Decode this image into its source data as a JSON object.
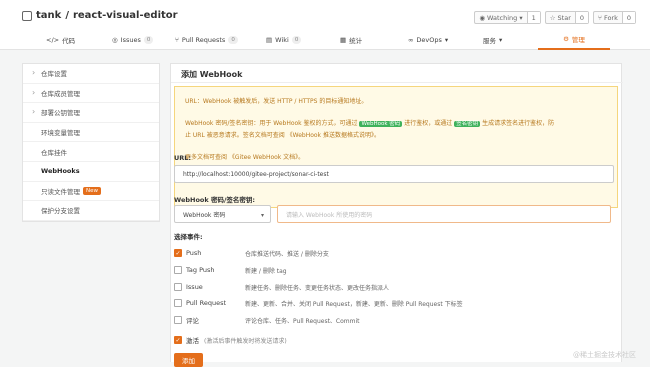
{
  "header": {
    "owner": "tank",
    "separator": "/",
    "repo": "react-visual-editor",
    "watch": {
      "label": "Watching",
      "count": "1"
    },
    "star": {
      "label": "Star",
      "count": "0"
    },
    "fork": {
      "label": "Fork",
      "count": "0"
    }
  },
  "tabs": [
    {
      "label": "代码",
      "icon": "</>",
      "badge": ""
    },
    {
      "label": "Issues",
      "icon": "◎",
      "badge": "0"
    },
    {
      "label": "Pull Requests",
      "icon": "⑂",
      "badge": "0"
    },
    {
      "label": "Wiki",
      "icon": "▤",
      "badge": "0"
    },
    {
      "label": "统计",
      "icon": "▦",
      "badge": ""
    },
    {
      "label": "DevOps",
      "icon": "∞",
      "badge": "▾"
    },
    {
      "label": "服务",
      "icon": "",
      "badge": "▾"
    },
    {
      "label": "管理",
      "icon": "⚙",
      "badge": ""
    }
  ],
  "sidebar": {
    "items": [
      {
        "label": "仓库设置",
        "new": ""
      },
      {
        "label": "仓库成员管理",
        "new": ""
      },
      {
        "label": "部署公钥管理",
        "new": ""
      },
      {
        "label": "环境变量管理",
        "new": ""
      },
      {
        "label": "仓库挂件",
        "new": ""
      },
      {
        "label": "WebHooks",
        "new": ""
      },
      {
        "label": "只读文件管理",
        "new": "New"
      },
      {
        "label": "保护分支设置",
        "new": ""
      }
    ]
  },
  "main": {
    "title": "添加 WebHook",
    "notice": {
      "line1": "URL：WebHook 被触发后，发送 HTTP / HTTPS 的目标通知地址。",
      "line2a": "WebHook 密码/签名密钥：用于 WebHook 鉴权的方式，可通过",
      "tag1": "WebHook 密码",
      "line2b": "进行鉴权，或通过",
      "tag2": "签名密钥",
      "line2c": "生成请求签名进行鉴权，防",
      "line3": "止 URL 被恶意请求。签名文档可查阅 《WebHook 推送数据格式说明》。",
      "line4": "更多文档可查阅 《Gitee WebHook 文档》。"
    },
    "url": {
      "label": "URL:",
      "value": "http://localhost:10000/gitee-project/sonar-ci-test"
    },
    "secret": {
      "label": "WebHook 密码/签名密钥:",
      "type_value": "WebHook 密码",
      "placeholder": "请输入 WebHook 所使用的密码"
    },
    "events_label": "选择事件:",
    "events": [
      {
        "name": "Push",
        "desc": "仓库推送代码、推送 / 删除分支",
        "checked": true
      },
      {
        "name": "Tag Push",
        "desc": "新建 / 删除 tag",
        "checked": false
      },
      {
        "name": "Issue",
        "desc": "新建任务、删除任务、变更任务状态、更改任务指派人",
        "checked": false
      },
      {
        "name": "Pull Request",
        "desc": "新建、更新、合并、关闭 Pull Request，新建、更新、删除 Pull Request 下标签",
        "checked": false
      },
      {
        "name": "评论",
        "desc": "评论仓库、任务、Pull Request、Commit",
        "checked": false
      }
    ],
    "activate": {
      "label": "激活",
      "desc": "(激活后事件触发时将发送请求)",
      "checked": true
    },
    "add_button": "添加"
  },
  "watermark": "@稀土掘金技术社区",
  "colors": {
    "accent": "#e46e1b",
    "tag_green": "#3fb25c",
    "notice_bg": "#fffae6"
  }
}
